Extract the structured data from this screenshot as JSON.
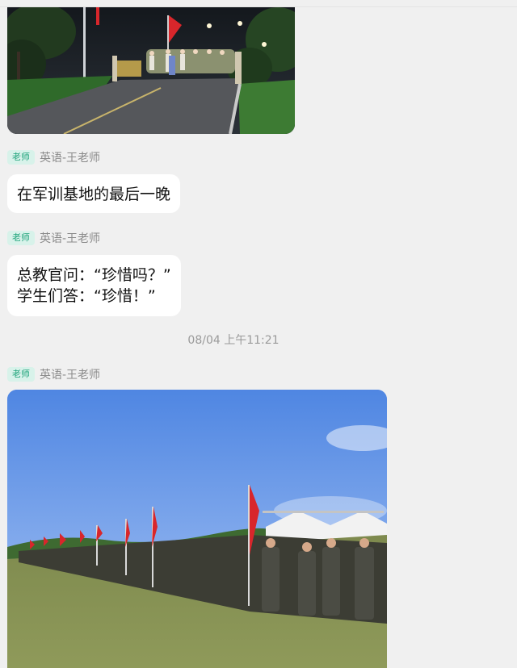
{
  "colors": {
    "page_bg": "#f0f0f0",
    "bubble_bg": "#ffffff",
    "badge_bg": "#d8f2ea",
    "badge_text": "#1ea37a",
    "name_text": "#8a8a8a",
    "timestamp_text": "#9a9a9a"
  },
  "messages": [
    {
      "type": "image",
      "image_description": "night-march-photo"
    },
    {
      "type": "text",
      "sender": {
        "role": "老师",
        "name": "英语-王老师"
      },
      "lines": [
        "在军训基地的最后一晚"
      ]
    },
    {
      "type": "text",
      "sender": {
        "role": "老师",
        "name": "英语-王老师"
      },
      "lines": [
        "总教官问：“珍惜吗？”",
        "学生们答：“珍惜！”"
      ]
    },
    {
      "type": "timestamp",
      "text": "08/04 上午11:21"
    },
    {
      "type": "image",
      "sender": {
        "role": "老师",
        "name": "英语-王老师"
      },
      "image_description": "formation-with-red-flags-photo"
    }
  ]
}
